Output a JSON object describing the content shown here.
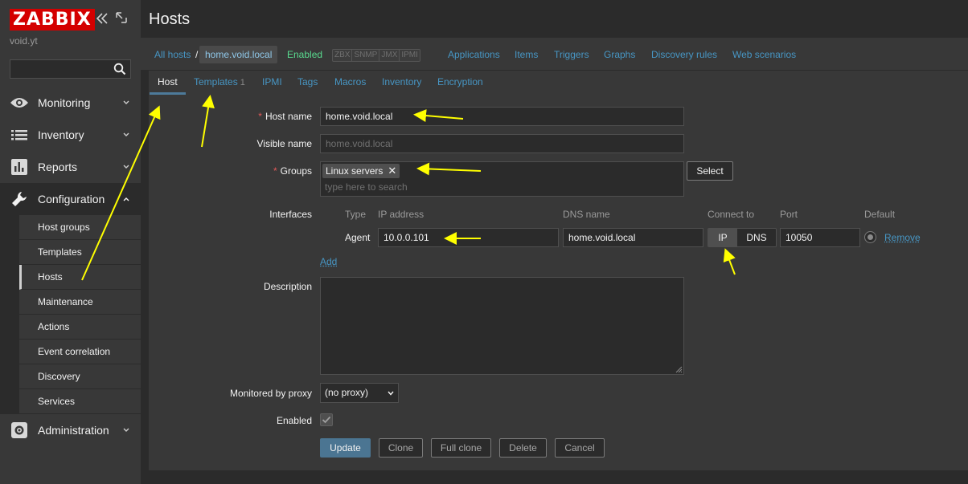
{
  "sidebar": {
    "logo": "ZABBIX",
    "server_name": "void.yt",
    "search_placeholder": "",
    "sections": [
      {
        "label": "Monitoring",
        "icon": "eye-icon"
      },
      {
        "label": "Inventory",
        "icon": "list-icon"
      },
      {
        "label": "Reports",
        "icon": "bar-chart-icon"
      },
      {
        "label": "Configuration",
        "icon": "wrench-icon"
      },
      {
        "label": "Administration",
        "icon": "gear-icon"
      }
    ],
    "config_items": [
      "Host groups",
      "Templates",
      "Hosts",
      "Maintenance",
      "Actions",
      "Event correlation",
      "Discovery",
      "Services"
    ],
    "selected_item": "Hosts"
  },
  "header": {
    "title": "Hosts"
  },
  "nav": {
    "all_hosts": "All hosts",
    "separator": "/",
    "current_host": "home.void.local",
    "status": "Enabled",
    "availability": [
      "ZBX",
      "SNMP",
      "JMX",
      "IPMI"
    ],
    "links": [
      "Applications",
      "Items",
      "Triggers",
      "Graphs",
      "Discovery rules",
      "Web scenarios"
    ]
  },
  "tabs": {
    "host": "Host",
    "templates": "Templates",
    "templates_count": "1",
    "ipmi": "IPMI",
    "tags": "Tags",
    "macros": "Macros",
    "inventory": "Inventory",
    "encryption": "Encryption"
  },
  "form": {
    "host_name_label": "Host name",
    "host_name_value": "home.void.local",
    "visible_name_label": "Visible name",
    "visible_name_placeholder": "home.void.local",
    "groups_label": "Groups",
    "group_chip": "Linux servers",
    "groups_placeholder": "type here to search",
    "select_button": "Select",
    "interfaces_label": "Interfaces",
    "iface_headers": {
      "type": "Type",
      "ip": "IP address",
      "dns": "DNS name",
      "connect": "Connect to",
      "port": "Port",
      "default": "Default"
    },
    "iface_row": {
      "type": "Agent",
      "ip": "10.0.0.101",
      "dns": "home.void.local",
      "connect_ip": "IP",
      "connect_dns": "DNS",
      "port": "10050",
      "remove": "Remove"
    },
    "add_link": "Add",
    "description_label": "Description",
    "proxy_label": "Monitored by proxy",
    "proxy_value": "(no proxy)",
    "enabled_label": "Enabled",
    "buttons": {
      "update": "Update",
      "clone": "Clone",
      "full_clone": "Full clone",
      "delete": "Delete",
      "cancel": "Cancel"
    }
  },
  "colors": {
    "accent_link": "#4796c4",
    "logo_red": "#d40000",
    "enabled_green": "#59db8f",
    "annotation_yellow": "#ffff00"
  }
}
